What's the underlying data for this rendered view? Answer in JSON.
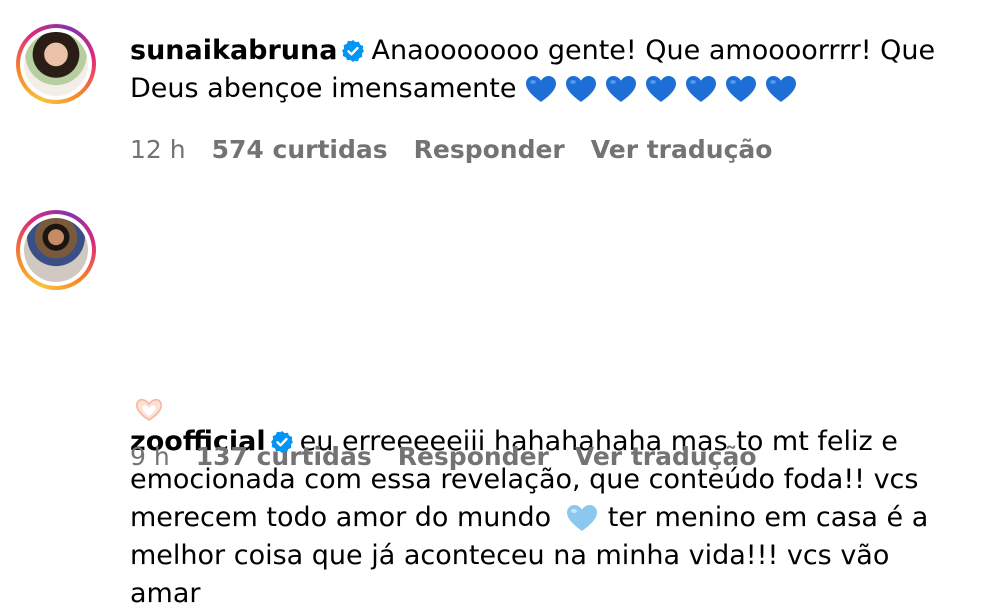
{
  "comments": [
    {
      "username": "sunaikabruna",
      "text": "Anaooooooo gente! Que amoooorrrr! Que Deus abençoe imensamente",
      "emoji": "💙💙💙💙💙💙💙",
      "time": "12 h",
      "likes": "574 curtidas",
      "reply": "Responder",
      "translate": "Ver tradução"
    },
    {
      "username": "zoofficial",
      "text_line1": "eu erreeeeeiii hahahahaha mas to mt feliz e",
      "text_line2": "emocionada com essa revelação, que conteúdo foda!! vcs",
      "text_line3a": "merecem todo amor do mundo",
      "text_line3b": "ter menino em casa é a",
      "text_line4": "melhor coisa que já aconteceu na minha vida!!! vcs vão amar",
      "time": "9 h",
      "likes": "137 curtidas",
      "reply": "Responder",
      "translate": "Ver tradução"
    }
  ],
  "colors": {
    "verified": "#0095f6",
    "dark_blue_heart": "#1d6fd6",
    "light_blue_heart": "#8cc7f0",
    "meta_gray": "#737373"
  }
}
